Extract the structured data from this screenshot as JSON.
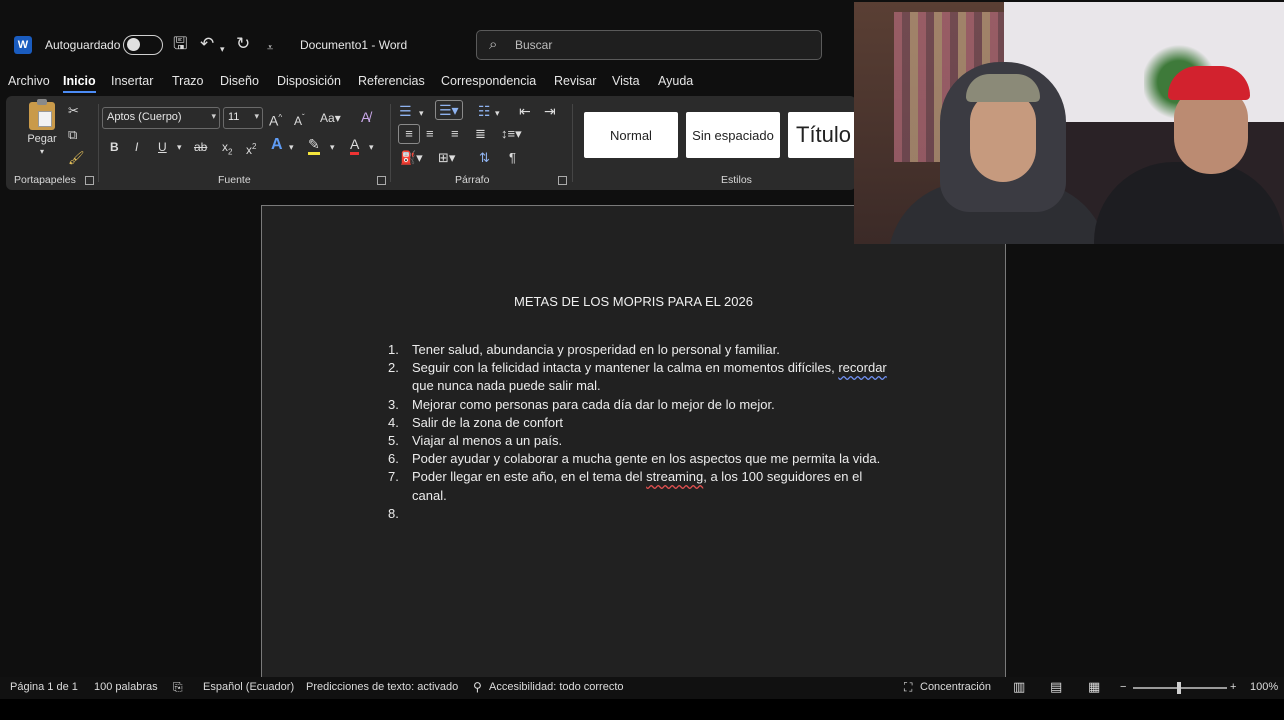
{
  "titlebar": {
    "app_logo": "W",
    "autosave_label": "Autoguardado",
    "doc_title": "Documento1 - Word",
    "search_placeholder": "Buscar"
  },
  "tabs": [
    "Archivo",
    "Inicio",
    "Insertar",
    "Trazo",
    "Diseño",
    "Disposición",
    "Referencias",
    "Correspondencia",
    "Revisar",
    "Vista",
    "Ayuda"
  ],
  "active_tab": "Inicio",
  "ribbon": {
    "clipboard": {
      "paste_label": "Pegar",
      "group_label": "Portapapeles"
    },
    "font": {
      "font_name": "Aptos (Cuerpo)",
      "font_size": "11",
      "case_label": "Aa",
      "group_label": "Fuente"
    },
    "paragraph": {
      "group_label": "Párrafo"
    },
    "styles": {
      "items": [
        "Normal",
        "Sin espaciado",
        "Título"
      ],
      "group_label": "Estilos"
    }
  },
  "document": {
    "heading": "METAS DE LOS MOPRIS PARA EL 2026",
    "items": [
      {
        "num": "1.",
        "text": "Tener salud, abundancia y prosperidad en lo personal y familiar."
      },
      {
        "num": "2.",
        "text_a": "Seguir con la felicidad intacta y mantener la calma en momentos difíciles,",
        "text_b_mark": "recordar",
        "text_b_rest": " que nunca nada puede salir mal."
      },
      {
        "num": "3.",
        "text": "Mejorar como personas para cada día dar lo mejor de lo mejor."
      },
      {
        "num": "4.",
        "text": "Salir de la zona de confort"
      },
      {
        "num": "5.",
        "text": "Viajar al menos a un país."
      },
      {
        "num": "6.",
        "text": "Poder ayudar y colaborar a mucha gente en los aspectos que me permita la vida."
      },
      {
        "num": "7.",
        "text_a": "Poder llegar en este año, en el tema del ",
        "text_mark": "streaming",
        "text_b": ", a los 100 seguidores en el canal."
      },
      {
        "num": "8.",
        "text": ""
      }
    ]
  },
  "statusbar": {
    "page": "Página 1 de 1",
    "words": "100 palabras",
    "language": "Español (Ecuador)",
    "predictions": "Predicciones de texto: activado",
    "accessibility": "Accesibilidad: todo correcto",
    "focus": "Concentración",
    "zoom": "100%"
  },
  "colors": {
    "accent": "#4c8cf5",
    "word_blue": "#1a5cbf"
  }
}
